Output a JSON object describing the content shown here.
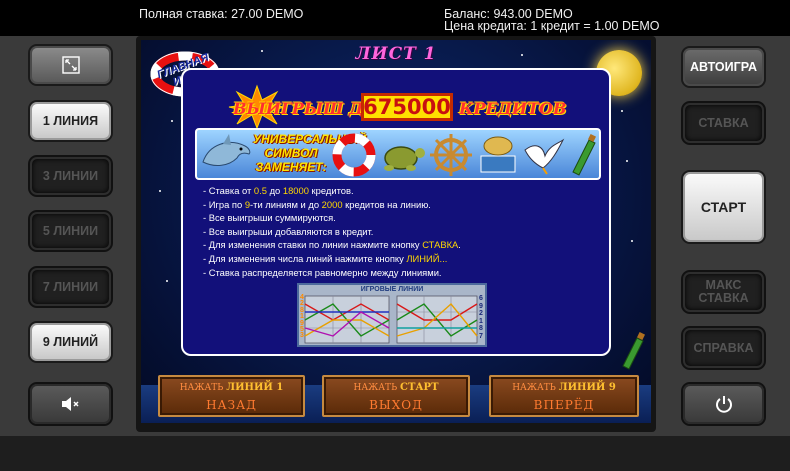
{
  "topbar": {
    "total_bet": "Полная ставка: 27.00 DEMO",
    "balance": "Баланс: 943.00 DEMO",
    "credit_price": "Цена кредита: 1 кредит = 1.00 DEMO"
  },
  "left_panel": {
    "fullscreen_icon": "fullscreen-icon",
    "lines": [
      {
        "label": "1 ЛИНИЯ",
        "state": "enabled"
      },
      {
        "label": "3 ЛИНИИ",
        "state": "disabled"
      },
      {
        "label": "5 ЛИНИИ",
        "state": "disabled"
      },
      {
        "label": "7 ЛИНИИ",
        "state": "disabled"
      },
      {
        "label": "9 ЛИНИЙ",
        "state": "enabled"
      }
    ],
    "mute_icon": "speaker-mute-icon"
  },
  "right_panel": {
    "autoplay": "АВТОИГРА",
    "bet": "СТАВКА",
    "start": "СТАРТ",
    "max_bet": "МАКС СТАВКА",
    "help": "СПРАВКА",
    "power_icon": "power-icon"
  },
  "game": {
    "logo_text": "ГЛАВНАЯ ИГРА",
    "sheet_title": "ЛИСТ 1",
    "win_prefix": "ВЫИГРЫШ ДО",
    "win_amount": "675000",
    "win_suffix": "КРЕДИТОВ",
    "wild_text": "УНИВЕРСАЛЬНЫЙ СИМВОЛ ЗАМЕНЯЕТ:",
    "symbols": [
      "dolphin-icon",
      "lifebuoy-icon",
      "turtle-icon",
      "ship-wheel-icon",
      "oyster-can-icon",
      "seagull-icon",
      "bottle-icon"
    ],
    "rules": [
      {
        "parts": [
          [
            "- Ставка от ",
            false
          ],
          [
            "0.5",
            true
          ],
          [
            " до ",
            false
          ],
          [
            "18000",
            true
          ],
          [
            " кредитов.",
            false
          ]
        ]
      },
      {
        "parts": [
          [
            "- Игра по ",
            false
          ],
          [
            "9",
            true
          ],
          [
            "-ти линиям и до ",
            false
          ],
          [
            "2000",
            true
          ],
          [
            " кредитов на линию.",
            false
          ]
        ]
      },
      {
        "parts": [
          [
            "- Все выигрыши суммируются.",
            false
          ]
        ]
      },
      {
        "parts": [
          [
            "- Все выигрыши добавляются в кредит.",
            false
          ]
        ]
      },
      {
        "parts": [
          [
            "- Для изменения ставки по линии нажмите кнопку ",
            false
          ],
          [
            "СТАВКА",
            true
          ],
          [
            ".",
            false
          ]
        ]
      },
      {
        "parts": [
          [
            "- Для изменения числа линий нажмите кнопку ",
            false
          ],
          [
            "ЛИНИЙ...",
            true
          ]
        ]
      },
      {
        "parts": [
          [
            "- Ставка распределяется равномерно между линиями.",
            false
          ]
        ]
      }
    ],
    "lines_title": "ИГРОВЫЕ ЛИНИИ",
    "lines_left_numbers": [
      "4",
      "2",
      "8",
      "1",
      "9",
      "5",
      "3"
    ],
    "lines_right_numbers": [
      "6",
      "9",
      "2",
      "1",
      "8",
      "7"
    ],
    "planks": [
      {
        "press": "НАЖАТЬ",
        "key": "ЛИНИЙ 1",
        "action": "НАЗАД"
      },
      {
        "press": "НАЖАТЬ",
        "key": "СТАРТ",
        "action": "ВЫХОД"
      },
      {
        "press": "НАЖАТЬ",
        "key": "ЛИНИЙ 9",
        "action": "ВПЕРЁД"
      }
    ]
  },
  "colors": {
    "highlight": "#ffd800",
    "panel_bg": "#12107a",
    "title_pink": "#ff66dd",
    "win_red": "#c81010"
  }
}
